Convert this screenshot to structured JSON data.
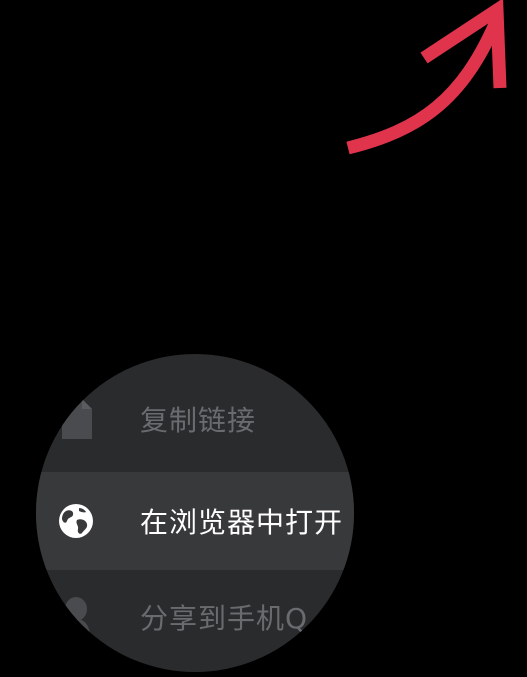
{
  "menu": {
    "items": [
      {
        "label": "复制链接",
        "icon": "copy-document-icon",
        "state": "dimmed"
      },
      {
        "label": "在浏览器中打开",
        "icon": "globe-icon",
        "state": "highlighted"
      },
      {
        "label": "分享到手机Q",
        "icon": "person-icon",
        "state": "dimmed"
      }
    ]
  },
  "colors": {
    "background": "#000000",
    "arrow": "#e0344d",
    "menu_bg": "#2a2b2d",
    "highlight_bg": "#38393b",
    "text_bright": "#ffffff",
    "text_dim": "#6a6b6e"
  }
}
